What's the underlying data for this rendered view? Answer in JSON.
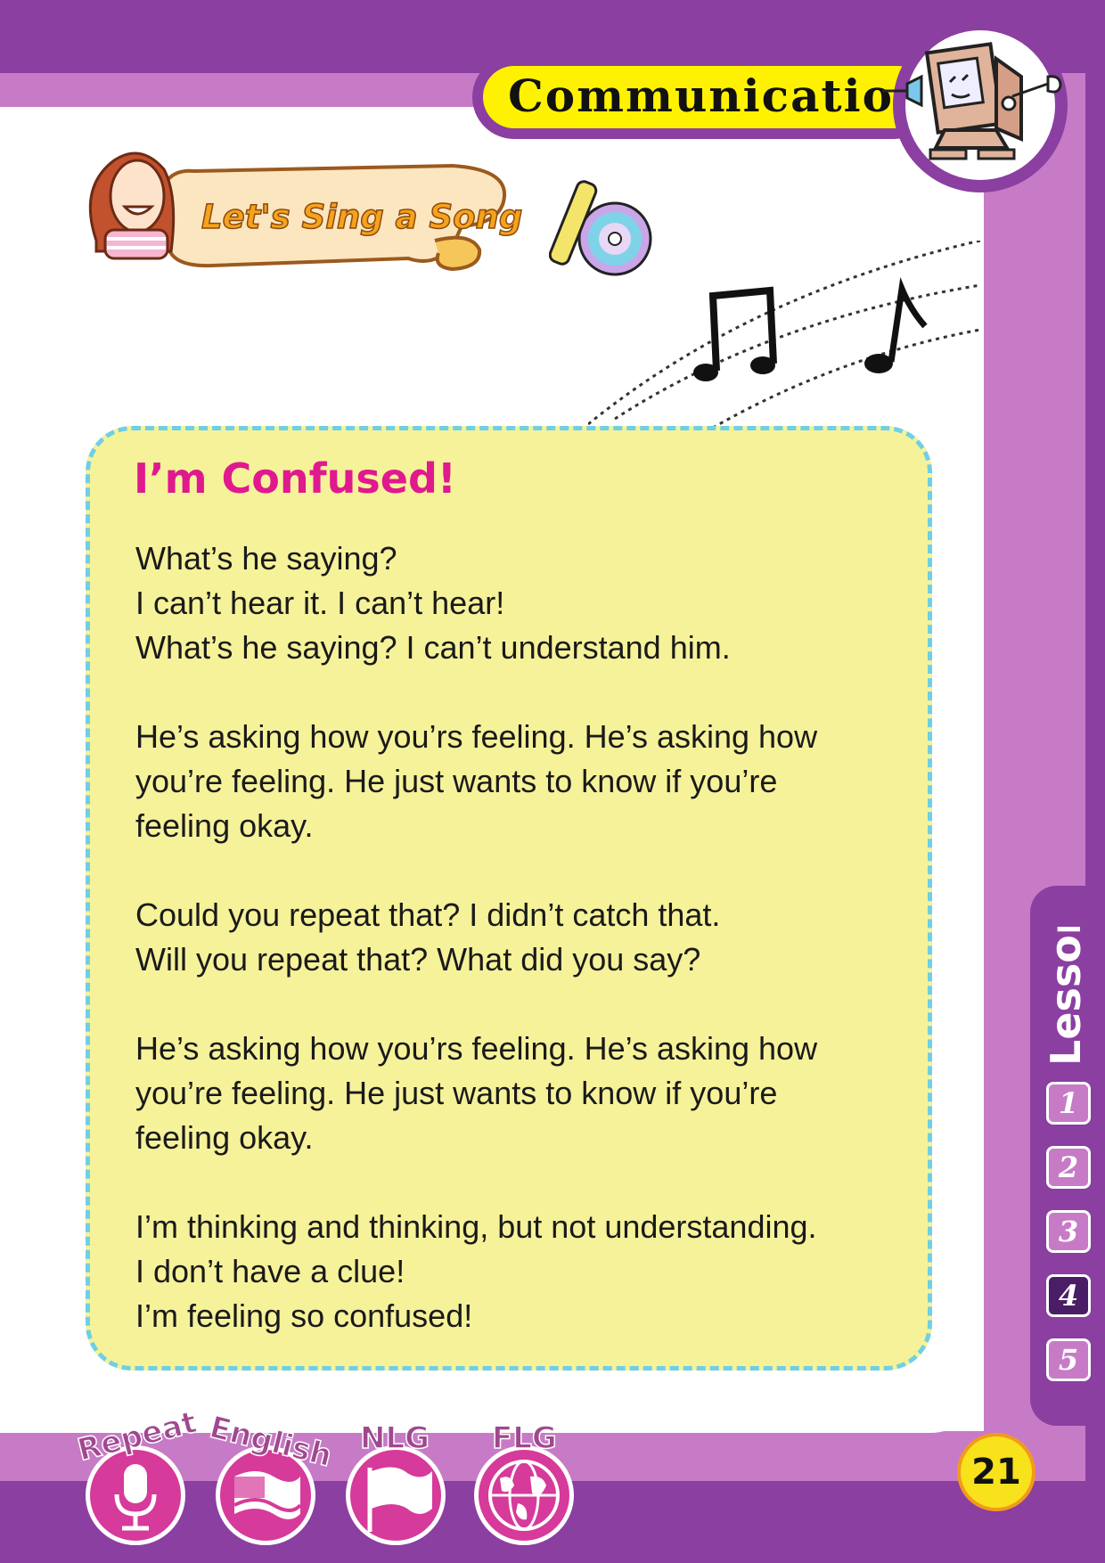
{
  "header": {
    "section_title": "Communication"
  },
  "activity": {
    "banner_label": "Let's Sing a Song"
  },
  "song": {
    "title": "I’m Confused!",
    "stanzas": [
      [
        "What’s he saying?",
        "I can’t hear it. I can’t hear!",
        "What’s he saying? I can’t understand him."
      ],
      [
        "He’s asking how you’rs feeling. He’s asking how",
        "you’re feeling. He just wants to know if you’re",
        "feeling okay."
      ],
      [
        "Could you repeat that? I didn’t catch that.",
        "Will you repeat that? What did you say?"
      ],
      [
        "He’s asking how you’rs feeling. He’s asking how",
        "you’re feeling. He just wants to know if you’re",
        "feeling okay."
      ],
      [
        "I’m thinking and thinking, but not understanding.",
        "I don’t have a clue!",
        "I’m feeling so confused!"
      ]
    ]
  },
  "lesson_nav": {
    "label": "Lesson",
    "lessons": [
      "1",
      "2",
      "3",
      "4",
      "5"
    ],
    "active": "4"
  },
  "footer": {
    "badges": [
      "Repeat",
      "English",
      "NLG",
      "FLG"
    ],
    "page_number": "21"
  },
  "colors": {
    "purple": "#8a3fa1",
    "light_purple": "#c77bc6",
    "yellow_box": "#f6f29a",
    "title_pink": "#e0198f",
    "dash_blue": "#6fcfe4"
  }
}
